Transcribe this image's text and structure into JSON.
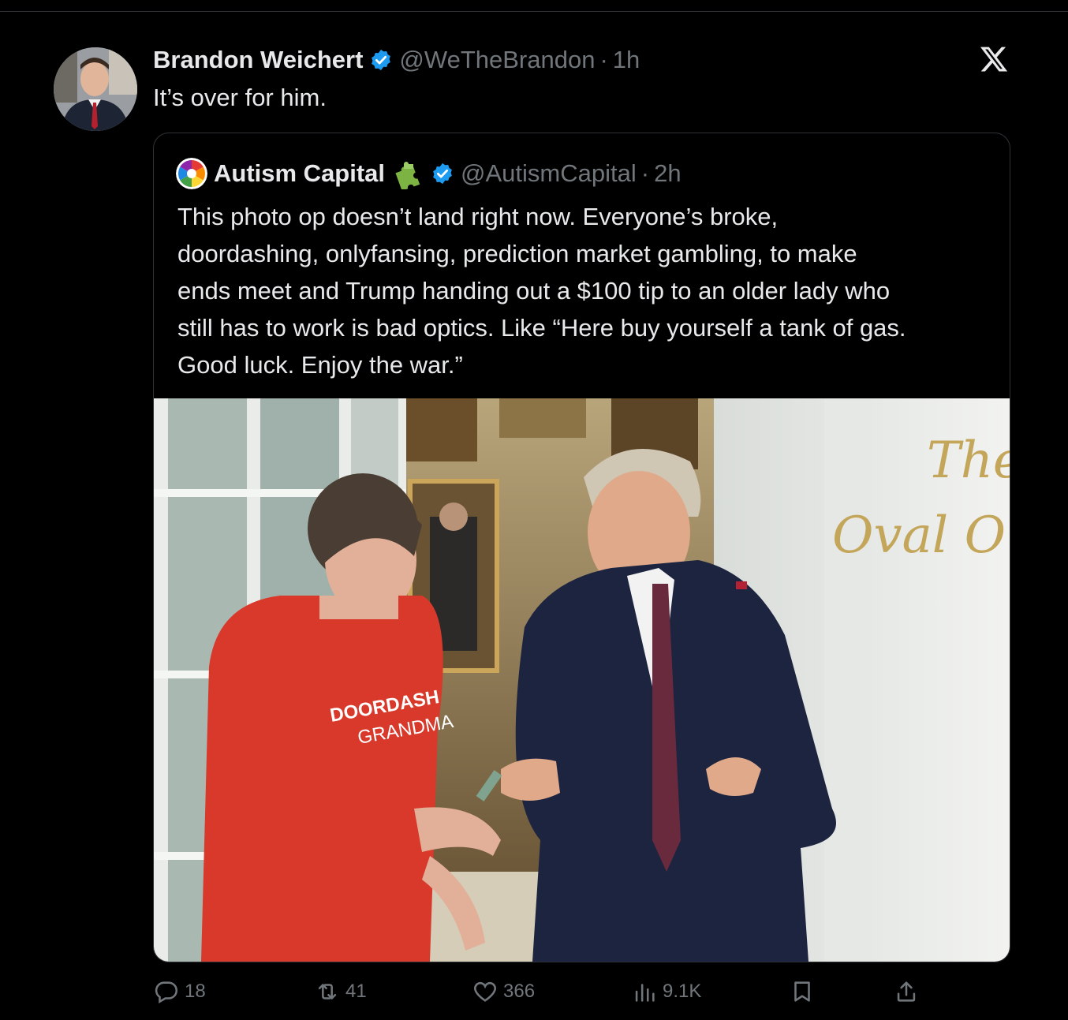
{
  "tweet": {
    "author_name": "Brandon Weichert",
    "author_handle": "@WeTheBrandon",
    "separator": "·",
    "time": "1h",
    "text": "It’s over for him."
  },
  "quoted_tweet": {
    "author_name": "Autism Capital",
    "author_handle": "@AutismCapital",
    "separator": "·",
    "time": "2h",
    "text_lines": [
      "This photo op doesn’t land right now. Everyone’s broke,",
      "doordashing, onlyfansing, prediction market gambling, to make",
      "ends meet and Trump handing out a $100 tip to an older lady who",
      "still has to work is bad optics. Like “Here buy yourself a tank of gas.",
      "Good luck. Enjoy the war.”"
    ],
    "image": {
      "shirt_text_1": "DOORDASH",
      "shirt_text_2": "GRANDMA",
      "wall_text_1": "The",
      "wall_text_2": "Oval O"
    }
  },
  "actions": {
    "replies": "18",
    "retweets": "41",
    "likes": "366",
    "views": "9.1K"
  },
  "icons": [
    "verified-badge-icon",
    "x-logo-icon",
    "puzzle-icon",
    "reply-icon",
    "retweet-icon",
    "like-icon",
    "views-icon",
    "bookmark-icon",
    "share-icon"
  ],
  "colors": {
    "background": "#000000",
    "text": "#e7e9ea",
    "muted": "#71767b",
    "verified": "#1d9bf0",
    "border": "#2f3336"
  }
}
